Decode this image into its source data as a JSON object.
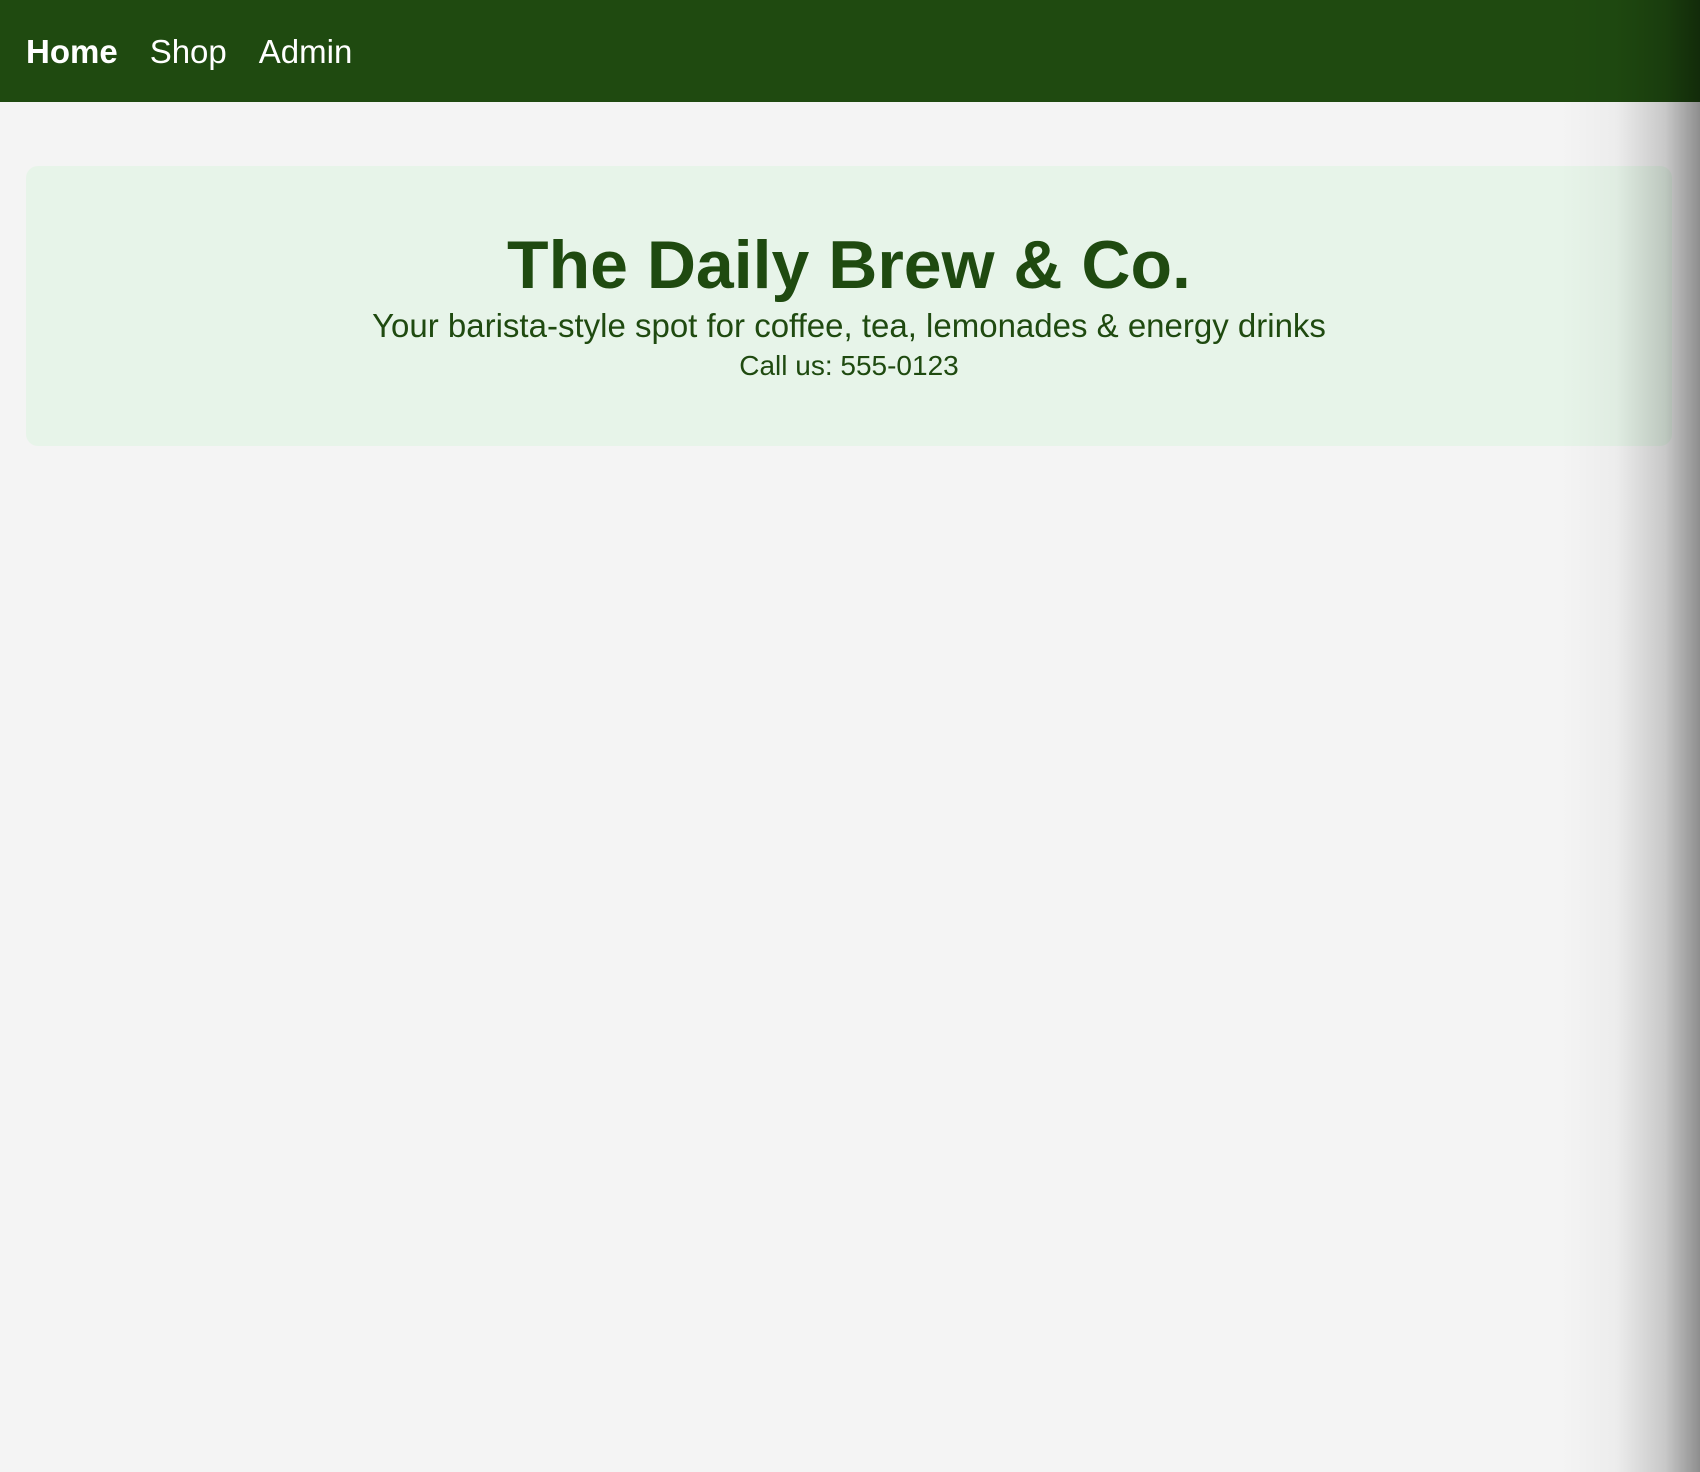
{
  "nav": {
    "items": [
      {
        "label": "Home",
        "active": true
      },
      {
        "label": "Shop",
        "active": false
      },
      {
        "label": "Admin",
        "active": false
      }
    ]
  },
  "hero": {
    "title": "The Daily Brew & Co.",
    "tagline": "Your barista-style spot for coffee, tea, lemonades & energy drinks",
    "phone": "Call us: 555-0123"
  },
  "colors": {
    "nav_background": "#1f4a10",
    "page_background": "#f4f4f4",
    "hero_background": "#e7f4e9",
    "hero_text": "#1f4a10",
    "nav_text": "#ffffff"
  }
}
